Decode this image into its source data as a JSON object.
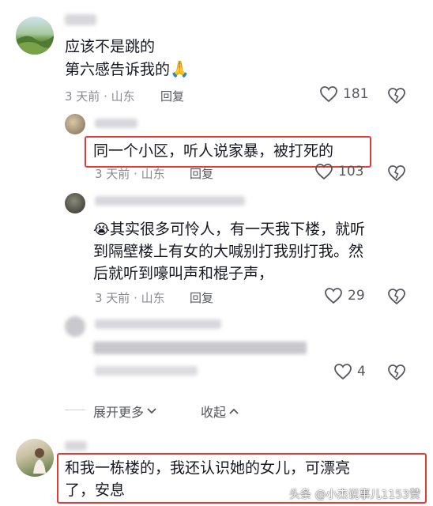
{
  "comments": [
    {
      "line1": "应该不是跳的",
      "line2": "第六感告诉我的",
      "emoji": "🙏",
      "meta": "3 天前 · 山东",
      "reply": "回复",
      "likes": "181"
    },
    {
      "text": "同一个小区，听人说家暴，被打死的",
      "meta": "3 天前 · 山东",
      "reply": "回复",
      "likes": "103"
    },
    {
      "emoji": "😭",
      "line1": "其实很多可怜人，有一天我下楼，就听",
      "line2": "到隔壁楼上有女的大喊别打我别打我。然",
      "line3": "后就听到嚎叫声和棍子声，",
      "meta": "3 天前 · 山东",
      "reply": "回复",
      "likes": "29"
    },
    {
      "likes": "4"
    },
    {
      "line1": "和我一栋楼的，我还认识她的女儿，可漂亮",
      "line2": "了，安息"
    }
  ],
  "expand_more": "展开更多",
  "collapse": "收起",
  "watermark": "头条 @小杰说事儿1153赞",
  "colors": {
    "highlight": "#e53935",
    "text": "#161823",
    "meta": "#8a8b91"
  }
}
